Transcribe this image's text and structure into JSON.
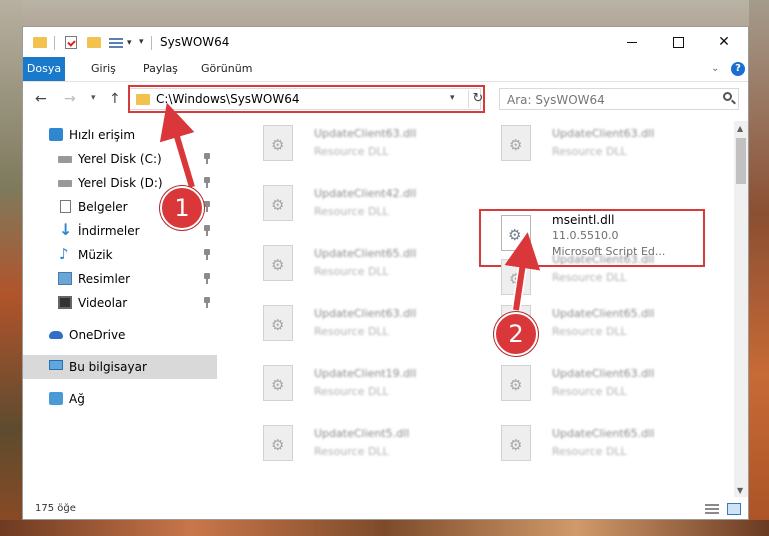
{
  "window": {
    "title": "SysWOW64"
  },
  "ribbon": {
    "tabs": [
      "Dosya",
      "Giriş",
      "Paylaş",
      "Görünüm"
    ]
  },
  "nav": {
    "address": "C:\\Windows\\SysWOW64",
    "search_placeholder": "Ara: SysWOW64"
  },
  "sidebar": {
    "items": [
      {
        "label": "Hızlı erişim",
        "icon": "star-icon"
      },
      {
        "label": "Yerel Disk (C:)",
        "icon": "disk-icon",
        "pinned": true
      },
      {
        "label": "Yerel Disk (D:)",
        "icon": "disk-icon",
        "pinned": true
      },
      {
        "label": "Belgeler",
        "icon": "documents-icon",
        "pinned": true
      },
      {
        "label": "İndirmeler",
        "icon": "downloads-icon",
        "pinned": true
      },
      {
        "label": "Müzik",
        "icon": "music-icon",
        "pinned": true
      },
      {
        "label": "Resimler",
        "icon": "pictures-icon",
        "pinned": true
      },
      {
        "label": "Videolar",
        "icon": "videos-icon",
        "pinned": true
      },
      {
        "label": "OneDrive",
        "icon": "onedrive-icon"
      },
      {
        "label": "Bu bilgisayar",
        "icon": "computer-icon",
        "selected": true
      },
      {
        "label": "Ağ",
        "icon": "network-icon"
      }
    ]
  },
  "files": {
    "left_column": [
      {
        "name": "UpdateClient63.dll",
        "desc": "Resource DLL"
      },
      {
        "name": "UpdateClient42.dll",
        "desc": "Resource DLL"
      },
      {
        "name": "UpdateClient65.dll",
        "desc": "Resource DLL"
      },
      {
        "name": "UpdateClient63.dll",
        "desc": "Resource DLL"
      },
      {
        "name": "UpdateClient19.dll",
        "desc": "Resource DLL"
      },
      {
        "name": "UpdateClient5.dll",
        "desc": "Resource DLL"
      }
    ],
    "right_column": [
      {
        "name": "UpdateClient63.dll",
        "desc": "Resource DLL"
      },
      {
        "name": "mseintl.dll",
        "version": "11.0.5510.0",
        "desc": "Microsoft Script Ed...",
        "highlighted": true
      },
      {
        "name": "UpdateClient63.dll",
        "desc": "Resource DLL"
      },
      {
        "name": "UpdateClient65.dll",
        "desc": "Resource DLL"
      },
      {
        "name": "UpdateClient63.dll",
        "desc": "Resource DLL"
      },
      {
        "name": "UpdateClient65.dll",
        "desc": "Resource DLL"
      }
    ]
  },
  "status": {
    "item_count": "175 öğe"
  },
  "callouts": [
    "1",
    "2"
  ],
  "colors": {
    "highlight": "#d63b3b",
    "callout": "#d9373a",
    "ribbon_file": "#1979ca"
  }
}
